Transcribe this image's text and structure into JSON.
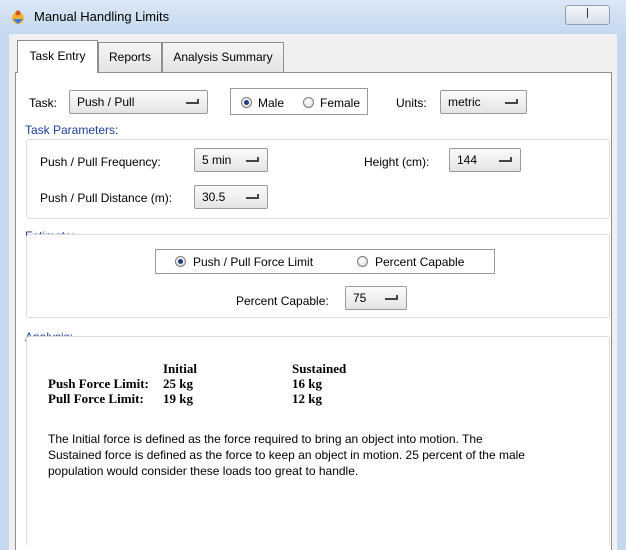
{
  "window": {
    "title": "Manual Handling Limits",
    "close_glyph": "ꟾ"
  },
  "tabs": [
    {
      "label": "Task Entry",
      "active": true
    },
    {
      "label": "Reports",
      "active": false
    },
    {
      "label": "Analysis Summary",
      "active": false
    }
  ],
  "task": {
    "label": "Task:",
    "value": "Push / Pull",
    "gender_options": [
      {
        "label": "Male",
        "selected": true
      },
      {
        "label": "Female",
        "selected": false
      }
    ],
    "units_label": "Units:",
    "units_value": "metric"
  },
  "task_parameters": {
    "header": "Task Parameters:",
    "frequency_label": "Push / Pull Frequency:",
    "frequency_value": "5 min",
    "height_label": "Height (cm):",
    "height_value": "144",
    "distance_label": "Push / Pull Distance (m):",
    "distance_value": "30.5"
  },
  "estimate": {
    "header": "Estimate:",
    "options": [
      {
        "label": "Push / Pull Force Limit",
        "selected": true
      },
      {
        "label": "Percent Capable",
        "selected": false
      }
    ],
    "percent_label": "Percent Capable:",
    "percent_value": "75"
  },
  "analysis": {
    "header": "Analysis:",
    "col_initial": "Initial",
    "col_sustained": "Sustained",
    "rows": [
      {
        "label": "Push Force Limit:",
        "initial": "25 kg",
        "sustained": "16 kg"
      },
      {
        "label": "Pull Force Limit:",
        "initial": "19 kg",
        "sustained": "12 kg"
      }
    ],
    "description_lines": [
      "The Initial force is defined as the force required to bring an object into motion.  The",
      "Sustained force is defined as the force to keep an object in motion.  25 percent of the male",
      "population would consider these loads too great to handle."
    ]
  },
  "colors": {
    "header_blue": "#1f3d9a",
    "title_bar": "#c5d8ee"
  }
}
